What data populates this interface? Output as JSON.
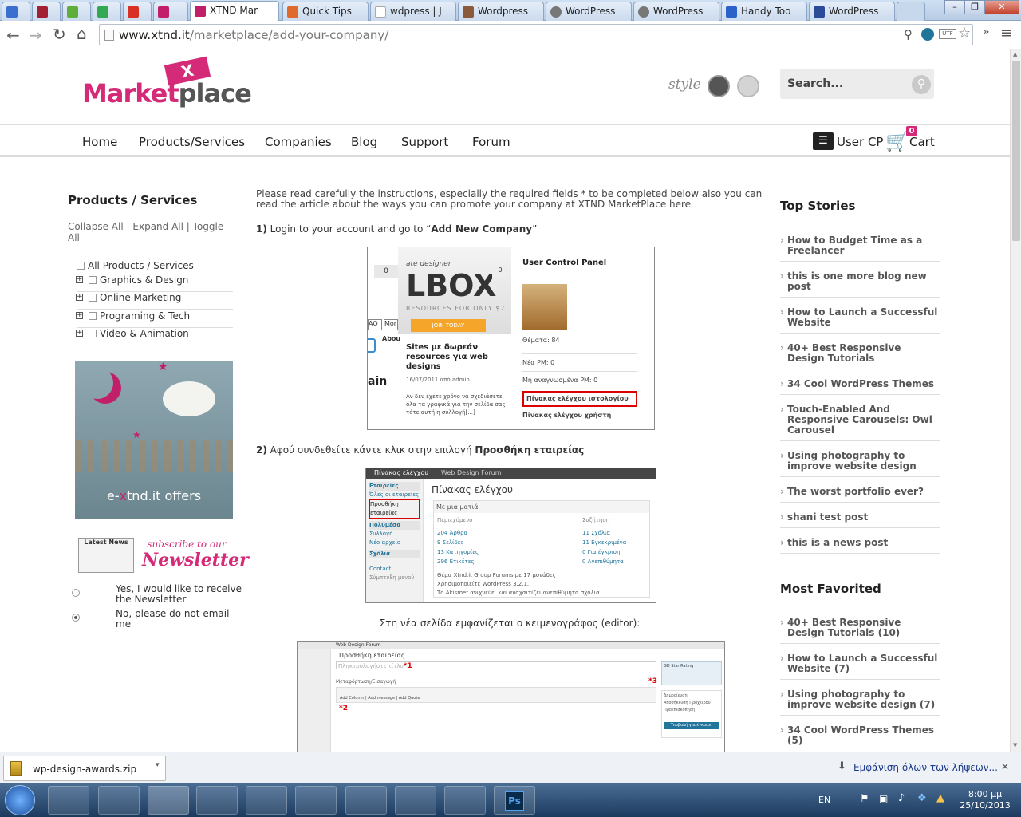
{
  "tabs": [
    {
      "label": ""
    },
    {
      "label": ""
    },
    {
      "label": ""
    },
    {
      "label": ""
    },
    {
      "label": ""
    },
    {
      "label": ""
    },
    {
      "label": "XTND Mar"
    },
    {
      "label": "Quick Tips"
    },
    {
      "label": "wdpress | J"
    },
    {
      "label": "Wordpress"
    },
    {
      "label": "WordPress"
    },
    {
      "label": "WordPress"
    },
    {
      "label": "Handy Too"
    },
    {
      "label": "WordPress"
    }
  ],
  "address": {
    "host": "www.xtnd.it",
    "path": "/marketplace/add-your-company/"
  },
  "site": {
    "logo": {
      "word1": "Market",
      "word2": "place",
      "badge": "X"
    },
    "style_label": "style",
    "search_placeholder": "Search...",
    "nav": [
      "Home",
      "Products/Services",
      "Companies",
      "Blog",
      "Support",
      "Forum"
    ],
    "user_cp": "User CP",
    "cart": "Cart",
    "cart_count": "0"
  },
  "left": {
    "heading": "Products / Services",
    "collapse": "Collapse All",
    "expand": "Expand All",
    "toggle": "Toggle",
    "all": "All",
    "sep": "|",
    "categories": [
      "All Products / Services",
      "Graphics & Design",
      "Online Marketing",
      "Programing & Tech",
      "Video & Animation"
    ],
    "banner_text_1": "e-",
    "banner_text_x": "x",
    "banner_text_2": "tnd.it offers",
    "newspaper_label": "Latest News",
    "newsletter_small": "subscribe to our",
    "newsletter_big": "Newsletter",
    "radio_yes": "Yes, I would like to receive the Newsletter",
    "radio_no": "No, please do not email me"
  },
  "main": {
    "intro": "Please read carefully the instructions, especially the required fields * to be completed below also you can read the article about the ways you can promote your company at XTND MarketPlace here",
    "step1_prefix": "1)",
    "step1_text": " Login to your account and go to “",
    "step1_bold": "Add New Company",
    "step1_end": "”",
    "step2_prefix": "2)",
    "step2_text": " Αφού συνδεθείτε κάντε κλικ  στην επιλογή  ",
    "step2_bold": "Προσθήκη εταιρείας",
    "step3_text": "Στη νέα σελίδα εμφανίζεται ο κειμενογράφος (editor):",
    "shot1": {
      "tagline": "ate designer",
      "big": "LBOX",
      "sub": "RESOURCES FOR ONLY $7",
      "btn": "JOIN TODAY",
      "counter": "0",
      "tab_aq": "AQ",
      "tab_mor": "Mor",
      "abou": "Abou",
      "ain": "ain",
      "post_title": "Sites με δωρεάν resources για web designs",
      "post_meta": "16/07/2011 από admin",
      "post_body": "Αν δεν έχετε χρόνο να σχεδιάσετε όλα τα γραφικά για την σελίδα σας τότε αυτή η συλλογή[...]",
      "ucp_title": "User Control Panel",
      "items": [
        "Θέματα: 84",
        "Νέα PM: 0",
        "Μη αναγνωσμένα PM: 0",
        "Πίνακας ελέγχου ιστολογίου",
        "Πίνακας ελέγχου χρήστη"
      ]
    },
    "shot2": {
      "topbar": "Πίνακας ελέγχου",
      "forum": "Web Design Forum",
      "side": [
        "Εταιρείες",
        "Όλες οι εταιρείες",
        "Προσθήκη εταιρείας",
        "Πολυμέσα",
        "Συλλογή",
        "Νέο αρχείο",
        "Σχόλια",
        "Contact",
        "Σύμπτυξη μενού"
      ],
      "title": "Πίνακας ελέγχου",
      "box_title": "Με μια ματιά",
      "content_h": "Περιεχόμενο",
      "discuss_h": "Συζήτηση",
      "rows_left": [
        "204 Άρθρα",
        "9 Σελίδες",
        "13 Κατηγορίες",
        "296 Ετικέτες"
      ],
      "rows_right": [
        "11 Σχόλια",
        "11 Εγκεκριμένα",
        "0 Για έγκριση",
        "0 Ανεπιθύμητα"
      ],
      "foot1": "Θέμα Xtnd.it Group Forums με 17 μονάδες",
      "foot2": "Χρησιμοποιείτε WordPress 3.2.1.",
      "foot3": "Το Akismet ανιχνεύει και αναχαιτίζει ανεπιθύμητα σχόλια."
    },
    "shot3": {
      "forum": "Web Design Forum",
      "title": "Προσθήκη εταιρείας",
      "field_placeholder": "Πληκτρολογήστε τίτλο",
      "m1": "*1",
      "m2": "*2",
      "m3": "*3",
      "toolbar_label": "Μεταφόρτωση/Εισαγωγή",
      "addcol": "Add Column",
      "addmsg": "Add message",
      "addquote": "Add Quote",
      "right_box": "GD Star Rating",
      "publish": "Δημοσίευση",
      "save": "Αποθήκευση Πρόχειρου",
      "preview": "Προεπισκόπηση",
      "update": "Υποβολή για έγκριση"
    }
  },
  "right": {
    "top_heading": "Top Stories",
    "top": [
      "How to Budget Time as a Freelancer",
      "this is one more blog new post",
      "How to Launch a Successful Website",
      "40+ Best Responsive Design Tutorials",
      "34 Cool WordPress Themes",
      "Touch-Enabled And Responsive Carousels: Owl Carousel",
      "Using photography to improve website design",
      "The worst portfolio ever?",
      "shani test post",
      "this is a news post"
    ],
    "fav_heading": "Most Favorited",
    "fav": [
      "40+ Best Responsive Design Tutorials (10)",
      "How to Launch a Successful Website (7)",
      "Using photography to improve website design (7)",
      "34 Cool WordPress Themes (5)"
    ]
  },
  "downloads": {
    "file": "wp-design-awards.zip",
    "show_all": "Εμφάνιση όλων των λήψεων..."
  },
  "taskbar": {
    "lang": "EN",
    "time": "8:00 μμ",
    "date": "25/10/2013",
    "ps": "Ps"
  }
}
